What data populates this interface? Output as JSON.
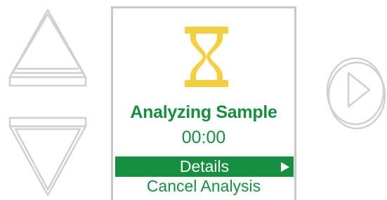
{
  "screen": {
    "title": "Analyzing Sample",
    "timer": "00:00",
    "menu": [
      {
        "label": "Details"
      },
      {
        "label": "Cancel Analysis"
      }
    ]
  },
  "colors": {
    "accent": "#15903f",
    "hourglass": "#f4d03f",
    "frame": "#c9c9c9",
    "hardware_button": "#d0d0d0"
  },
  "icons": {
    "up": "triangle-up-icon",
    "down": "triangle-down-icon",
    "play": "play-icon",
    "status": "hourglass-icon",
    "submenu": "chevron-right-icon"
  }
}
